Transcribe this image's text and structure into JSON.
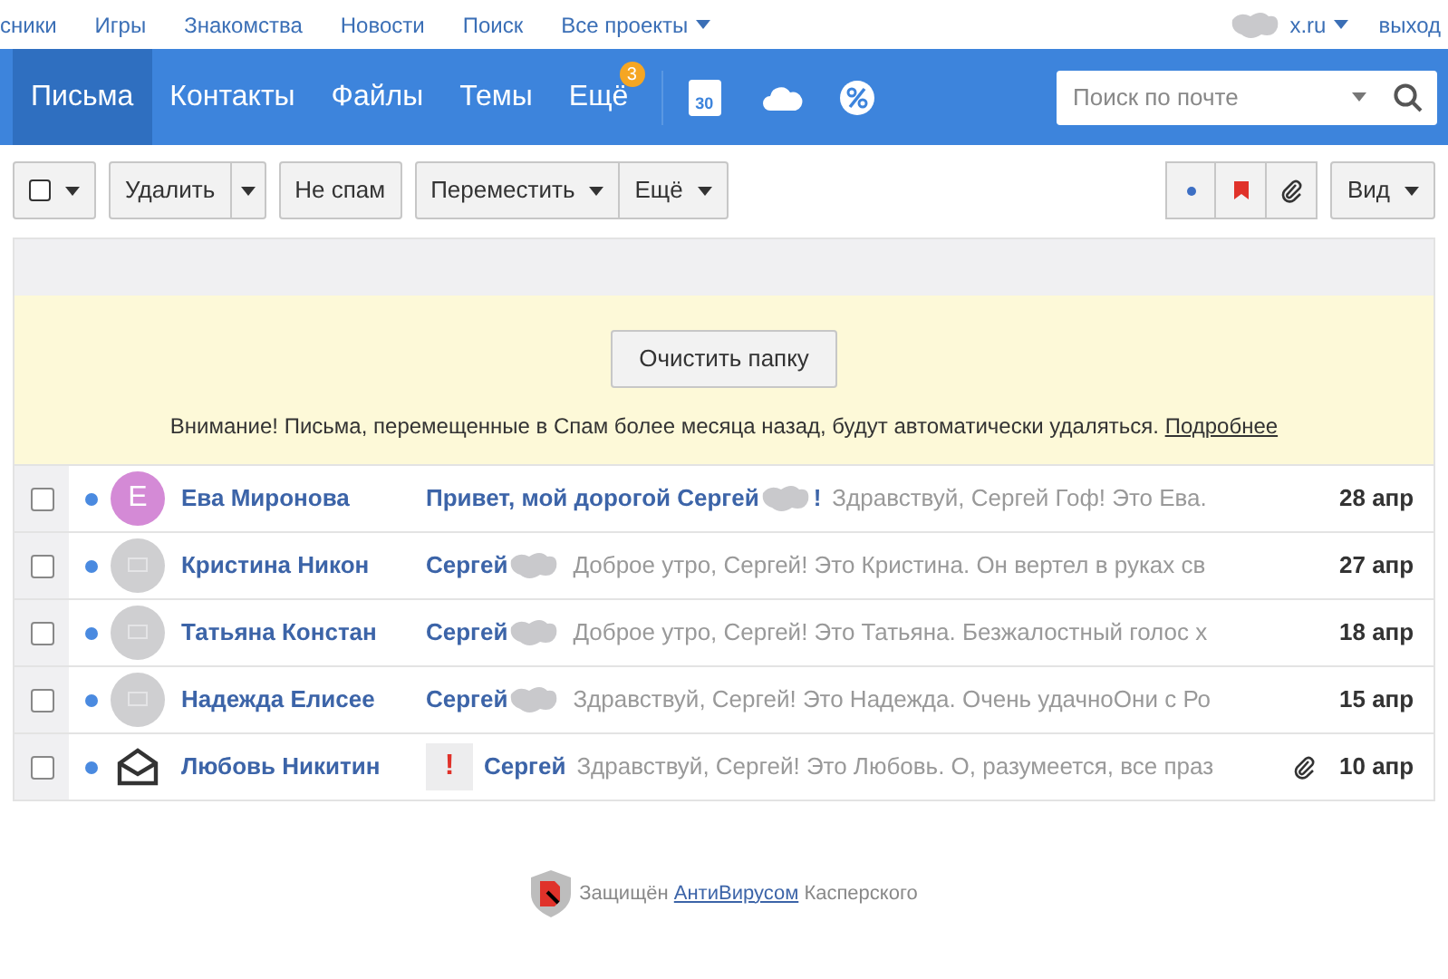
{
  "top_links": [
    {
      "label": "сники"
    },
    {
      "label": "Игры"
    },
    {
      "label": "Знакомства"
    },
    {
      "label": "Новости"
    },
    {
      "label": "Поиск"
    },
    {
      "label": "Все проекты",
      "dropdown": true
    }
  ],
  "account": {
    "email": "x.ru",
    "logout": "выход"
  },
  "nav_tabs": [
    {
      "label": "Письма",
      "selected": true
    },
    {
      "label": "Контакты",
      "selected": false
    },
    {
      "label": "Файлы",
      "selected": false
    },
    {
      "label": "Темы",
      "selected": false
    },
    {
      "label": "Ещё",
      "selected": false,
      "badge": "3"
    }
  ],
  "calendar_day": "30",
  "search": {
    "placeholder": "Поиск по почте"
  },
  "toolbar": {
    "select_all_checked": false,
    "delete": "Удалить",
    "not_spam": "Не спам",
    "move": "Переместить",
    "more": "Ещё",
    "view": "Вид"
  },
  "notice": {
    "button": "Очистить папку",
    "text": "Внимание! Письма, перемещенные в Спам более месяца назад, будут автоматически удаляться.",
    "link": "Подробнее"
  },
  "messages": [
    {
      "checked": false,
      "unread": true,
      "avatar": {
        "kind": "letter",
        "letter": "Е",
        "color": "#d48ad6"
      },
      "sender": "Ева Миронова",
      "subject": "Привет, мой дорогой Сергей",
      "subject_end": "!",
      "snippet": "Здравствуй, Сергей Гоф! Это Ева.",
      "attachment": false,
      "date": "28 апр"
    },
    {
      "checked": false,
      "unread": true,
      "avatar": {
        "kind": "placeholder"
      },
      "sender": "Кристина Никон",
      "subject": "Сергей",
      "snippet": "Доброе утро, Сергей! Это Кристина. Он вертел в руках св",
      "attachment": false,
      "date": "27 апр"
    },
    {
      "checked": false,
      "unread": true,
      "avatar": {
        "kind": "placeholder"
      },
      "sender": "Татьяна Констан",
      "subject": "Сергей",
      "snippet": "Доброе утро, Сергей! Это Татьяна. Безжалостный голос х",
      "attachment": false,
      "date": "18 апр"
    },
    {
      "checked": false,
      "unread": true,
      "avatar": {
        "kind": "placeholder"
      },
      "sender": "Надежда Елисее",
      "subject": "Сергей",
      "snippet": "Здравствуй, Сергей! Это Надежда. Очень удачноОни с Ро",
      "attachment": false,
      "date": "15 апр"
    },
    {
      "checked": false,
      "unread": true,
      "avatar": {
        "kind": "envelope"
      },
      "sender": "Любовь Никитин",
      "important_mark": "!",
      "subject": "Сергей",
      "snippet": "Здравствуй, Сергей! Это Любовь. О, разумеется, все праз",
      "attachment": true,
      "date": "10 апр"
    }
  ],
  "footer": {
    "before": "Защищён",
    "link": "АнтиВирусом",
    "after": "Касперского"
  }
}
